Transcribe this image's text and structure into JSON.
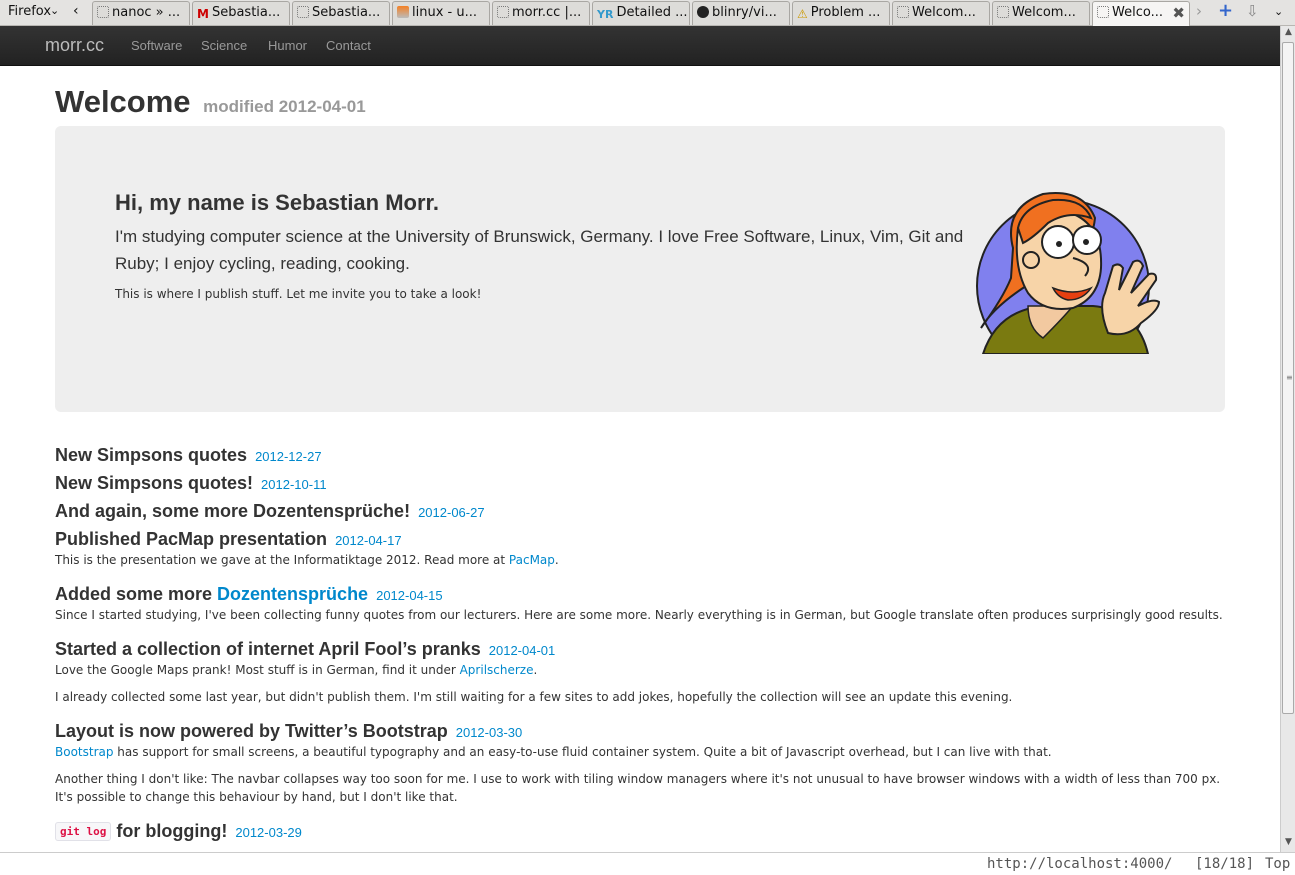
{
  "browser": {
    "menu_label": "Firefox",
    "tabs": [
      {
        "label": "nanoc » ...",
        "icon": "blank-icon"
      },
      {
        "label": "Sebastia...",
        "icon": "gmail-icon"
      },
      {
        "label": "Sebastia...",
        "icon": "blank-icon"
      },
      {
        "label": "linux - u...",
        "icon": "stackexchange-icon"
      },
      {
        "label": "morr.cc |...",
        "icon": "blank-icon"
      },
      {
        "label": "Detailed ...",
        "icon": "yr-icon"
      },
      {
        "label": "blinry/vi...",
        "icon": "github-icon"
      },
      {
        "label": "Problem ...",
        "icon": "warning-icon"
      },
      {
        "label": "Welcom...",
        "icon": "blank-icon"
      },
      {
        "label": "Welcom...",
        "icon": "blank-icon"
      },
      {
        "label": "Welco...",
        "icon": "blank-icon",
        "active": true
      }
    ],
    "status_url": "http://localhost:4000/",
    "status_position": "[18/18]",
    "status_scroll": "Top"
  },
  "navbar": {
    "brand": "morr.cc",
    "links": [
      "Software",
      "Science",
      "Humor",
      "Contact"
    ]
  },
  "page": {
    "title": "Welcome",
    "modified": "modified 2012-04-01"
  },
  "hero": {
    "title": "Hi, my name is Sebastian Morr.",
    "lead": "I'm studying computer science at the University of Brunswick, Germany. I love Free Software, Linux, Vim, Git and Ruby; I enjoy cycling, reading, cooking.",
    "small": "This is where I publish stuff. Let me invite you to take a look!"
  },
  "posts": [
    {
      "title": "New Simpsons quotes",
      "date": "2012-12-27"
    },
    {
      "title": "New Simpsons quotes!",
      "date": "2012-10-11"
    },
    {
      "title": "And again, some more Dozentensprüche!",
      "date": "2012-06-27"
    },
    {
      "title": "Published PacMap presentation",
      "date": "2012-04-17",
      "p1_pre": "This is the presentation we gave at the Informatiktage 2012. Read more at ",
      "p1_link": "PacMap",
      "p1_post": "."
    },
    {
      "title_pre": "Added some more ",
      "title_link": "Dozentensprüche",
      "date": "2012-04-15",
      "p1": "Since I started studying, I've been collecting funny quotes from our lecturers. Here are some more. Nearly everything is in German, but Google translate often produces surprisingly good results."
    },
    {
      "title": "Started a collection of internet April Fool’s pranks",
      "date": "2012-04-01",
      "p1_pre": "Love the Google Maps prank! Most stuff is in German, find it under ",
      "p1_link": "Aprilscherze",
      "p1_post": ".",
      "p2": "I already collected some last year, but didn't publish them. I'm still waiting for a few sites to add jokes, hopefully the collection will see an update this evening."
    },
    {
      "title": "Layout is now powered by Twitter’s Bootstrap",
      "date": "2012-03-30",
      "p1_link": "Bootstrap",
      "p1_post": " has support for small screens, a beautiful typography and an easy-to-use fluid container system. Quite a bit of Javascript overhead, but I can live with that.",
      "p2": "Another thing I don't like: The navbar collapses way too soon for me. I use to work with tiling window managers where it's not unusual to have browser windows with a width of less than 700 px. It's possible to change this behaviour by hand, but I don't like that."
    },
    {
      "title_code": "git log",
      "title_post": "for blogging!",
      "date": "2012-03-29"
    }
  ]
}
